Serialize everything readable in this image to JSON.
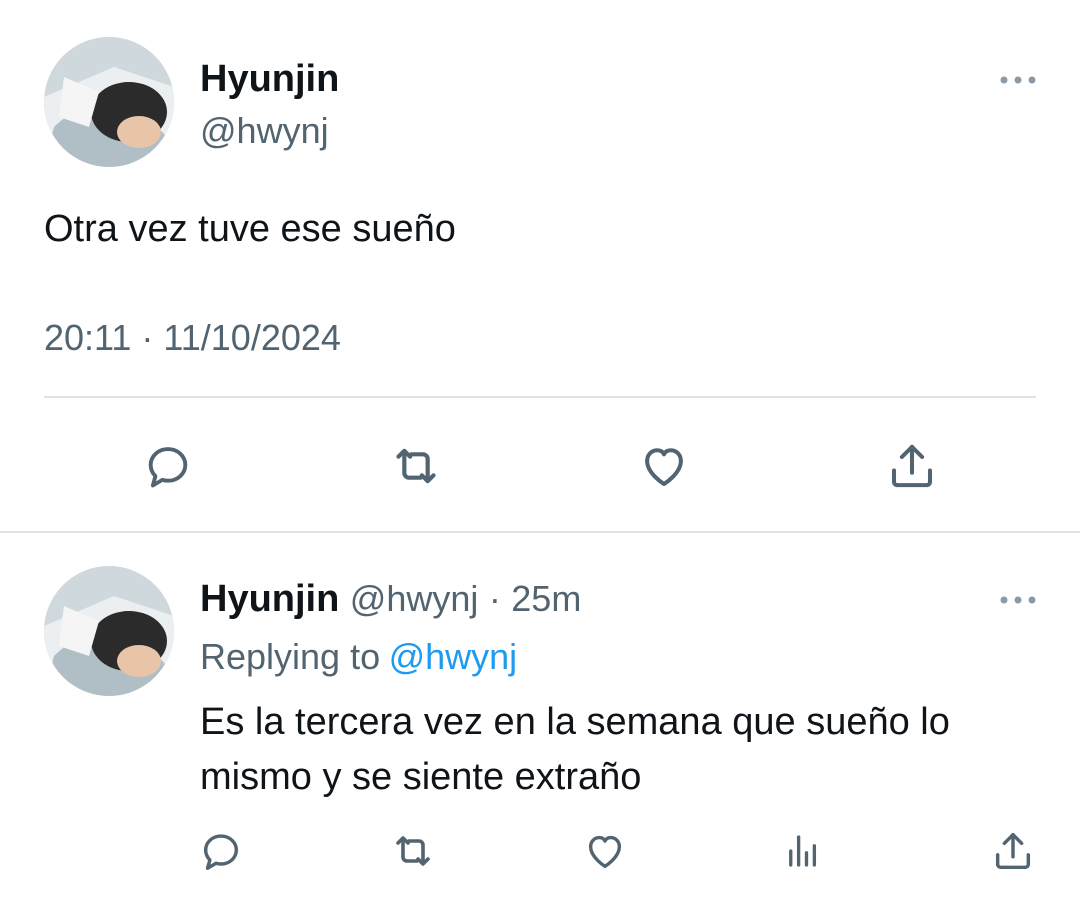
{
  "main_tweet": {
    "author_name": "Hyunjin",
    "author_handle": "@hwynj",
    "text": "Otra vez tuve ese sueño",
    "timestamp": "20:11 · 11/10/2024",
    "actions": [
      "reply-icon",
      "retweet-icon",
      "like-icon",
      "share-icon"
    ]
  },
  "reply_tweet": {
    "author_name": "Hyunjin",
    "author_handle": "@hwynj",
    "separator": "·",
    "age": "25m",
    "replying_label": "Replying to",
    "replying_handle": "@hwynj",
    "text_line1": "Es la tercera vez en la semana que sueño lo",
    "text_line2": "mismo y se siente extraño",
    "actions": [
      "reply-icon",
      "retweet-icon",
      "like-icon",
      "views-icon",
      "share-icon"
    ]
  },
  "colors": {
    "text": "#0f1419",
    "secondary": "#536471",
    "link": "#1d9bf0",
    "divider": "#dfe4e8"
  }
}
